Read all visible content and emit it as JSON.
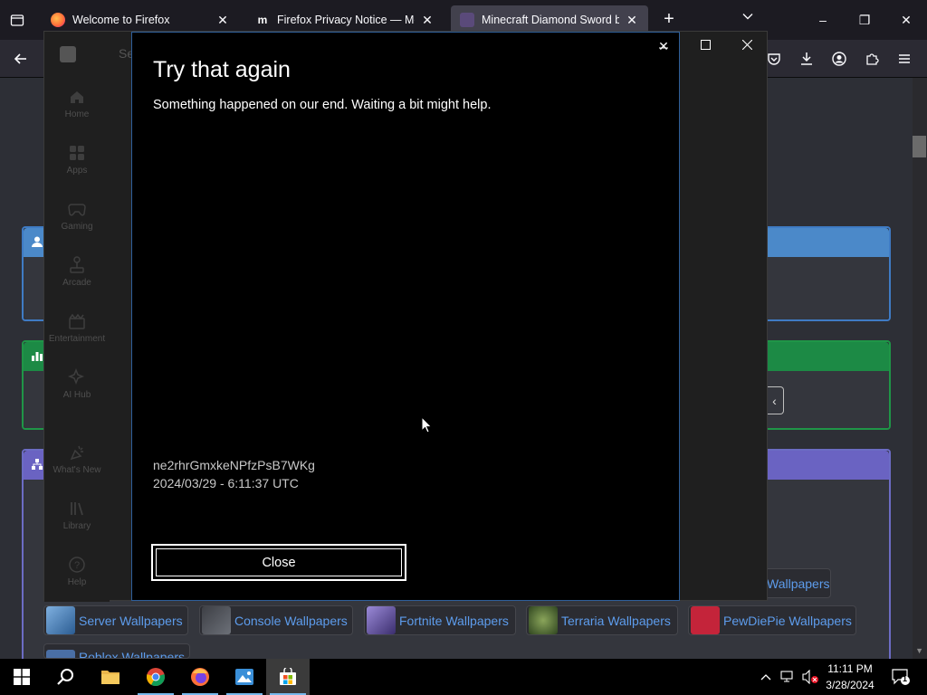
{
  "browser": {
    "tabs": [
      {
        "title": "Welcome to Firefox",
        "active": false,
        "favicon_color": "#ff7139"
      },
      {
        "title": "Firefox Privacy Notice — Mozilla",
        "active": false,
        "favicon_color": "#ffffff"
      },
      {
        "title": "Minecraft Diamond Sword by n",
        "active": true,
        "favicon_color": "#5a4a7a"
      }
    ],
    "new_tab_symbol": "+",
    "window_controls": {
      "minimize": "–",
      "restore": "❐",
      "close": "✕"
    }
  },
  "page": {
    "chips_row1": [
      {
        "label": "Server Wallpapers",
        "thumb": "#4a7fb5"
      },
      {
        "label": "Console Wallpapers",
        "thumb": "#555a63"
      },
      {
        "label": "Fortnite Wallpapers",
        "thumb": "#6b5aa8"
      },
      {
        "label": "Terraria Wallpapers",
        "thumb": "#5b7a3a"
      },
      {
        "label": "PewDiePie Wallpapers",
        "thumb": "#c4243a"
      }
    ],
    "chip_partial_right": "Wallpapers",
    "chip_partial_bottom": "Roblox Wallpapers"
  },
  "store": {
    "search_hint": "Se",
    "nav": [
      {
        "label": "Home",
        "icon": "home-icon"
      },
      {
        "label": "Apps",
        "icon": "apps-icon"
      },
      {
        "label": "Gaming",
        "icon": "gaming-icon"
      },
      {
        "label": "Arcade",
        "icon": "arcade-icon"
      },
      {
        "label": "Entertainment",
        "icon": "entertainment-icon"
      },
      {
        "label": "AI Hub",
        "icon": "ai-hub-icon"
      },
      {
        "label": "What's New",
        "icon": "whats-new-icon"
      },
      {
        "label": "Library",
        "icon": "library-icon"
      },
      {
        "label": "Help",
        "icon": "help-icon"
      }
    ]
  },
  "dialog": {
    "title": "Try that again",
    "message": "Something happened on our end. Waiting a bit might help.",
    "error_code": "ne2rhrGmxkeNPfzPsB7WKg",
    "timestamp": "2024/03/29 - 6:11:37 UTC",
    "close_label": "Close"
  },
  "taskbar": {
    "time": "11:11 PM",
    "date": "3/28/2024",
    "notification_count": "1"
  }
}
